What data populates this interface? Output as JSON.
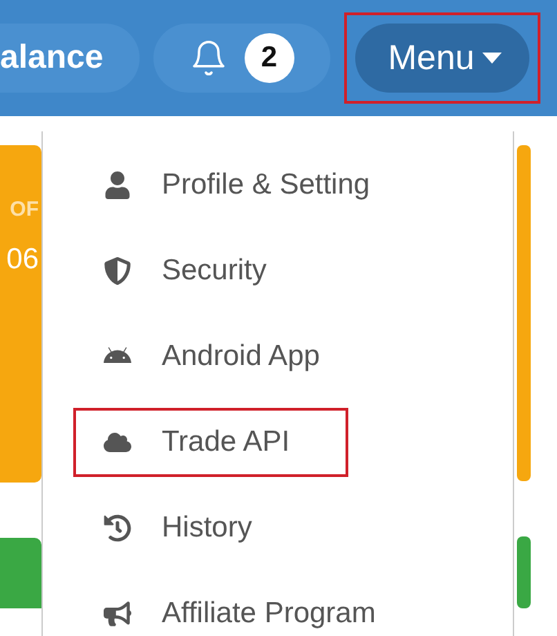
{
  "header": {
    "balance_button": "alance",
    "notifications": {
      "count": "2"
    },
    "menu_button": {
      "label": "Menu",
      "highlighted": true
    }
  },
  "card": {
    "label": "OF",
    "value": "06"
  },
  "menu_items": [
    {
      "label": "Profile & Setting",
      "highlighted": false
    },
    {
      "label": "Security",
      "highlighted": false
    },
    {
      "label": "Android App",
      "highlighted": false
    },
    {
      "label": "Trade API",
      "highlighted": true
    },
    {
      "label": "History",
      "highlighted": false
    },
    {
      "label": "Affiliate Program",
      "highlighted": false
    }
  ]
}
